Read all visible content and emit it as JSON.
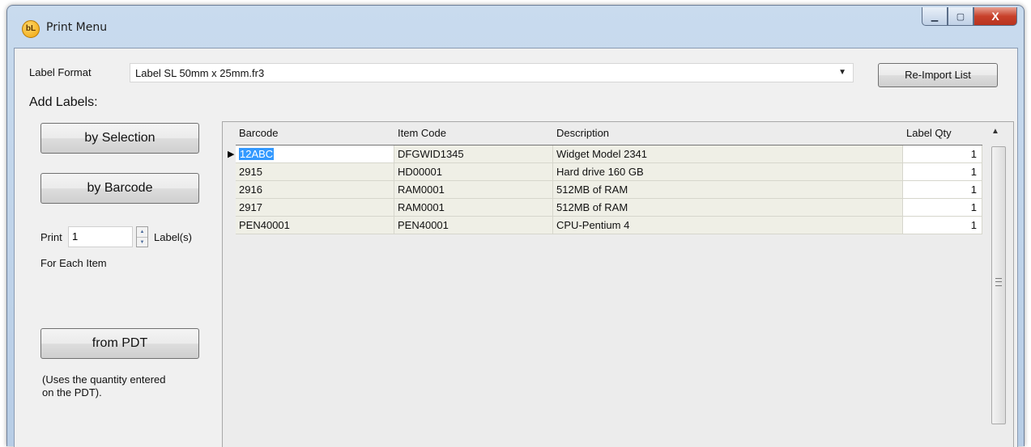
{
  "window": {
    "title": "Print Menu",
    "icon_text": "bL",
    "controls": {
      "minimize": "▁",
      "maximize": "▢",
      "close": "X"
    }
  },
  "label_format": {
    "label": "Label Format",
    "selected": "Label SL 50mm x 25mm.fr3",
    "reimport_button": "Re-Import List"
  },
  "add_labels": {
    "heading": "Add Labels:",
    "by_selection": "by Selection",
    "by_barcode": "by Barcode",
    "print_label": "Print",
    "print_qty": "1",
    "labels_suffix": "Label(s)",
    "for_each": "For Each Item",
    "from_pdt": "from PDT",
    "note_line1": "(Uses the quantity entered",
    "note_line2": "on the PDT)."
  },
  "grid": {
    "columns": [
      "Barcode",
      "Item Code",
      "Description",
      "Label Qty"
    ],
    "rows": [
      {
        "barcode": "12ABC",
        "item_code": "DFGWID1345",
        "description": "Widget Model 2341",
        "qty": "1",
        "current": true
      },
      {
        "barcode": "2915",
        "item_code": "HD00001",
        "description": "Hard drive 160 GB",
        "qty": "1"
      },
      {
        "barcode": "2916",
        "item_code": "RAM0001",
        "description": "512MB of RAM",
        "qty": "1"
      },
      {
        "barcode": "2917",
        "item_code": "RAM0001",
        "description": "512MB of RAM",
        "qty": "1"
      },
      {
        "barcode": "PEN40001",
        "item_code": "PEN40001",
        "description": "CPU-Pentium 4",
        "qty": "1"
      }
    ]
  }
}
